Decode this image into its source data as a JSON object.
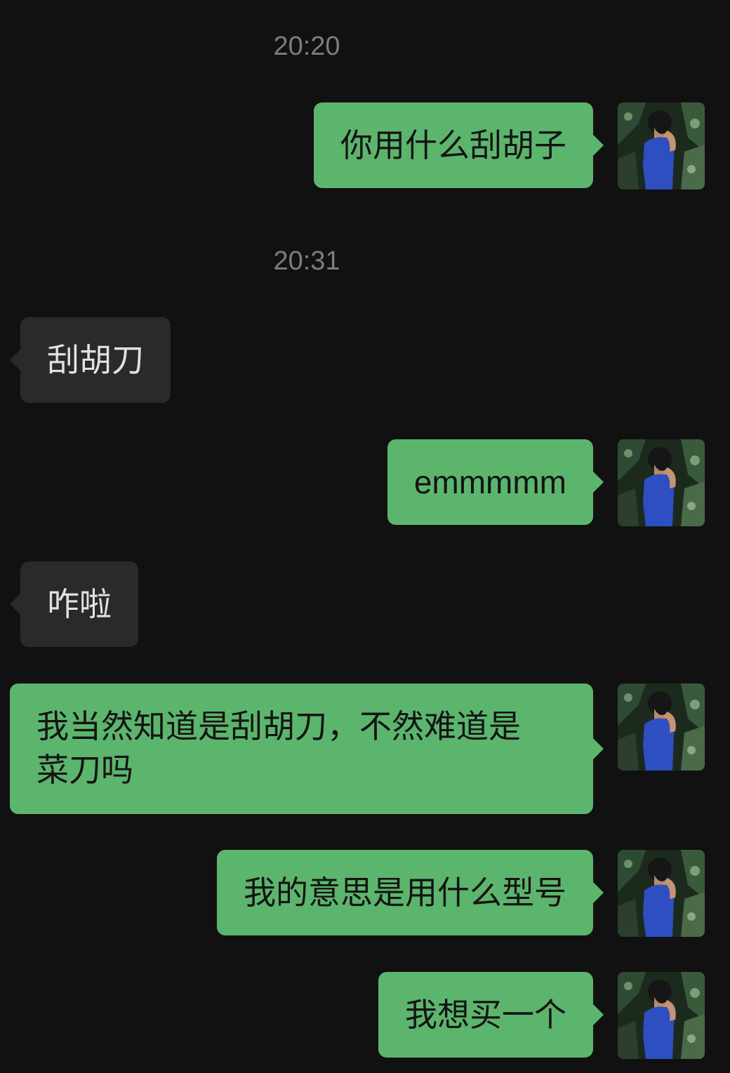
{
  "chat": {
    "timestamps": [
      "20:20",
      "20:31"
    ],
    "messages": [
      {
        "from": "me",
        "text": "你用什么刮胡子"
      },
      {
        "from": "other",
        "text": "刮胡刀"
      },
      {
        "from": "me",
        "text": "emmmmm"
      },
      {
        "from": "other",
        "text": "咋啦"
      },
      {
        "from": "me",
        "text": "我当然知道是刮胡刀，不然难道是\n菜刀吗"
      },
      {
        "from": "me",
        "text": "我的意思是用什么型号"
      },
      {
        "from": "me",
        "text": "我想买一个"
      }
    ]
  },
  "colors": {
    "background": "#111111",
    "sent_bubble": "#5cb56d",
    "received_bubble": "#2a2a2a",
    "timestamp": "#7d7d7d"
  },
  "avatar": {
    "icon": "person-in-blue-shirt-avatar"
  }
}
